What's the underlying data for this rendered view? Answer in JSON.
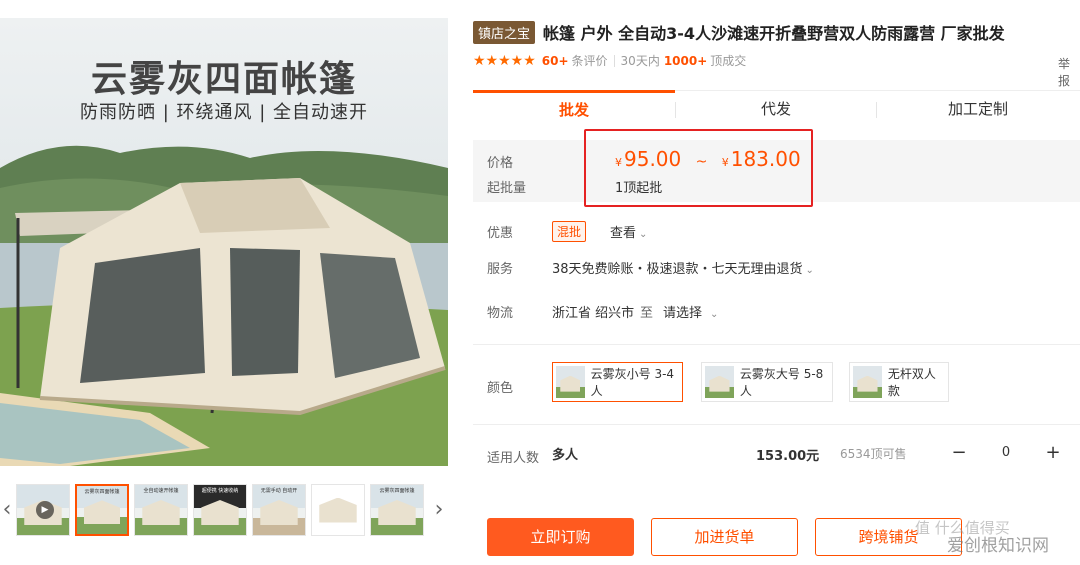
{
  "gallery": {
    "hero_title": "云雾灰四面帐篷",
    "hero_subtitle": "防雨防晒 | 环绕通风 | 全自动速开",
    "prev_arrow": "‹",
    "next_arrow": "›",
    "play_symbol": "▶",
    "thumbnails": [
      {
        "label": ""
      },
      {
        "label": "云雾灰四面帐篷"
      },
      {
        "label": "全自动速开帐篷"
      },
      {
        "label": "超便携 快速收纳"
      },
      {
        "label": "无需手动 自动开"
      },
      {
        "label": ""
      },
      {
        "label": "云雾灰四面帐篷"
      }
    ]
  },
  "product": {
    "shop_badge": "镇店之宝",
    "title": "帐篷 户外 全自动3-4人沙滩速开折叠野营双人防雨露营 厂家批发",
    "report": "举报",
    "stars": "★★★★★",
    "reviews_count": "60+",
    "reviews_label": "条评价",
    "sales_period": "30天内",
    "sales_count": "1000+",
    "sales_label": "顶成交"
  },
  "tabs": [
    "批发",
    "代发",
    "加工定制"
  ],
  "price": {
    "price_label": "价格",
    "moq_label": "起批量",
    "currency": "¥",
    "min": "95.00",
    "tilde": "~",
    "max": "183.00",
    "moq": "1顶起批"
  },
  "offers": {
    "label": "优惠",
    "badge": "混批",
    "view": "查看",
    "service_label": "服务",
    "service_value": "38天免费赊账・极速退款・七天无理由退货",
    "logistics_label": "物流",
    "origin": "浙江省 绍兴市",
    "to": "至",
    "destination": "请选择"
  },
  "sku": {
    "label": "颜色",
    "options": [
      {
        "name": "云雾灰小号 3-4人",
        "selected": true
      },
      {
        "name": "云雾灰大号 5-8人",
        "selected": false
      },
      {
        "name": "无杆双人款",
        "selected": false
      }
    ]
  },
  "quantity": {
    "label": "适用人数",
    "value_name": "多人",
    "unit_price": "153.00元",
    "stock": "6534顶可售",
    "minus": "−",
    "count": "0",
    "plus": "+"
  },
  "actions": {
    "buy_now": "立即订购",
    "add_to_list": "加进货单",
    "cross_border": "跨境铺货"
  },
  "watermark": {
    "text": "爱创根知识网",
    "faded": "值  什么值得买"
  },
  "colors": {
    "accent": "#ff5000",
    "badge_brown": "#7a5833",
    "highlight_red": "#e52222"
  }
}
